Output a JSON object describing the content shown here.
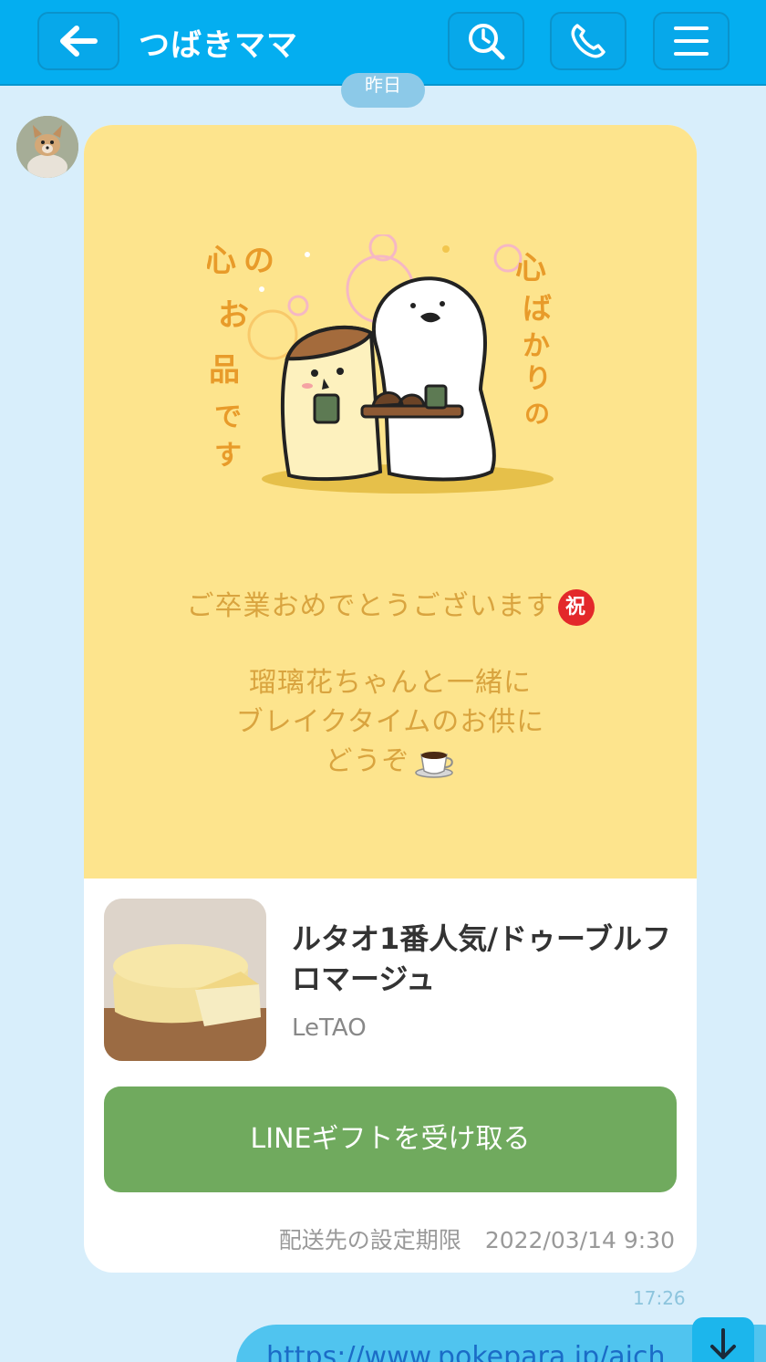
{
  "header": {
    "title": "つばきママ",
    "color": "#04aef0"
  },
  "date_divider": "昨日",
  "gift_card": {
    "message_line1": "ご卒業おめでとうございます",
    "message_line2": "瑠璃花ちゃんと一緒に",
    "message_line3": "ブレイクタイムのお供に",
    "message_line4": "どうぞ",
    "celebrate_badge": "祝",
    "sticker_left_text": "心のお品です",
    "sticker_right_text": "心ばかりの",
    "product_name": "ルタオ1番人気/ドゥーブルフロマージュ",
    "product_brand": "LeTAO",
    "receive_button": "LINEギフトを受け取る",
    "deadline_label": "配送先の設定期限",
    "deadline_value": "2022/03/14 9:30",
    "top_color": "#fde48d",
    "button_color": "#70aa5e"
  },
  "message_time": "17:26",
  "outgoing_message": "https://www.pokepara.jp/aich",
  "icons": [
    "back-arrow-icon",
    "search-icon",
    "phone-icon",
    "menu-icon",
    "celebrate-icon",
    "coffee-icon",
    "scroll-down-icon"
  ]
}
